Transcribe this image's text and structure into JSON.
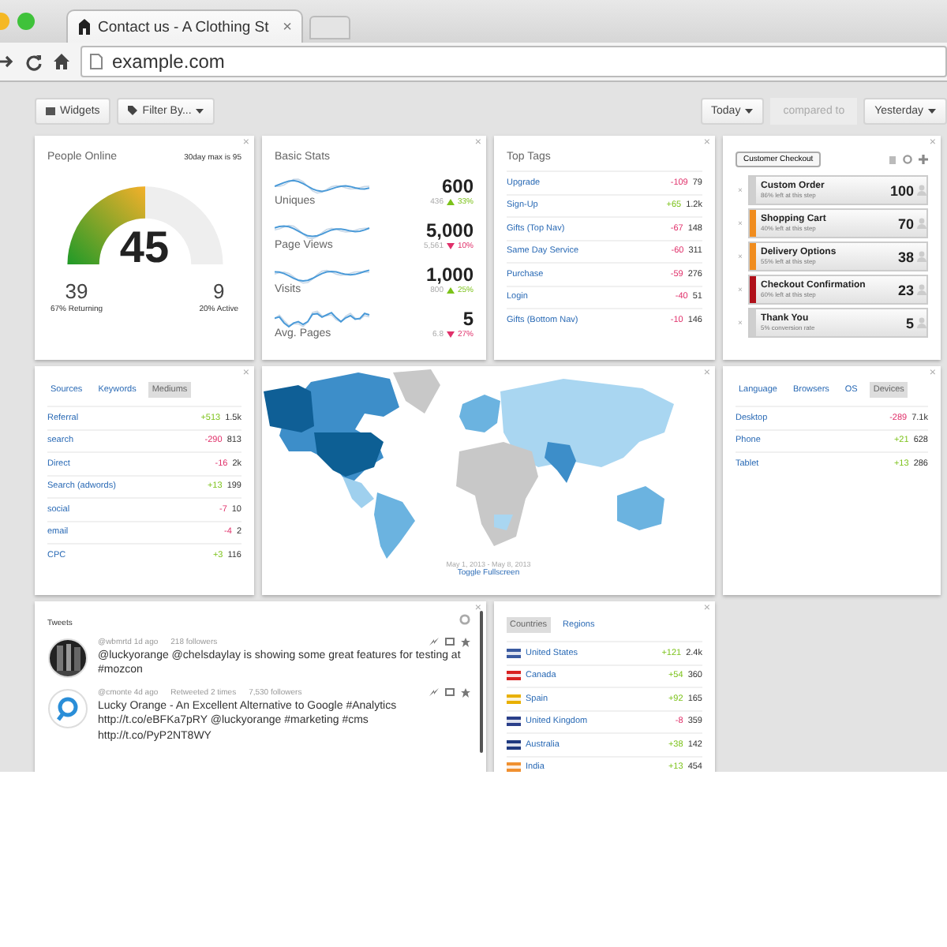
{
  "browser": {
    "tab_title": "Contact us - A Clothing St",
    "tab_close": "×",
    "url": "example.com"
  },
  "toolbar": {
    "widgets_button": "Widgets",
    "filter_button": "Filter By...",
    "range": "Today",
    "compare_label": "compared to",
    "compare_range": "Yesterday"
  },
  "people_online": {
    "close": "×",
    "title": "People Online",
    "max_note": "30day max is 95",
    "count": "45",
    "level": 0.5,
    "returning": "39",
    "returning_label": "67% Returning",
    "active": "9",
    "active_label": "20% Active"
  },
  "basic_stats": {
    "close": "×",
    "title": "Basic Stats",
    "rows": [
      {
        "label": "Uniques",
        "value": "600",
        "previous": "436",
        "change": "33%",
        "kind": "up"
      },
      {
        "label": "Page Views",
        "value": "5,000",
        "previous": "5,561",
        "change": "10%",
        "kind": "down"
      },
      {
        "label": "Visits",
        "value": "1,000",
        "previous": "800",
        "change": "25%",
        "kind": "up"
      },
      {
        "label": "Avg. Pages",
        "value": "5",
        "previous": "6.8",
        "change": "27%",
        "kind": "down"
      }
    ]
  },
  "top_tags": {
    "close": "×",
    "title": "Top Tags",
    "rows": [
      {
        "label": "Upgrade",
        "change": "-109",
        "value": "79",
        "kind": "down"
      },
      {
        "label": "Sign-Up",
        "change": "+65",
        "value": "1.2k",
        "kind": "up"
      },
      {
        "label": "Gifts (Top Nav)",
        "change": "-67",
        "value": "148",
        "kind": "down"
      },
      {
        "label": "Same Day Service",
        "change": "-60",
        "value": "311",
        "kind": "down"
      },
      {
        "label": "Purchase",
        "change": "-59",
        "value": "276",
        "kind": "down"
      },
      {
        "label": "Login",
        "change": "-40",
        "value": "51",
        "kind": "down"
      },
      {
        "label": "Gifts (Bottom Nav)",
        "change": "-10",
        "value": "146",
        "kind": "down"
      }
    ]
  },
  "checkout": {
    "close": "×",
    "funnel": "Customer Checkout",
    "steps": [
      {
        "remove": "×",
        "name": "Custom Order",
        "note": "86% left at this step",
        "count": "100",
        "color": "#cfcfcf"
      },
      {
        "remove": "×",
        "name": "Shopping Cart",
        "note": "40% left at this step",
        "count": "70",
        "color": "#f08c1e"
      },
      {
        "remove": "×",
        "name": "Delivery Options",
        "note": "55% left at this step",
        "count": "38",
        "color": "#f08c1e"
      },
      {
        "remove": "×",
        "name": "Checkout Confirmation",
        "note": "60% left at this step",
        "count": "23",
        "color": "#b0101a"
      },
      {
        "remove": "×",
        "name": "Thank You",
        "note": "5% conversion rate",
        "count": "5",
        "color": "#cfcfcf"
      }
    ]
  },
  "sources": {
    "close": "×",
    "tabs": [
      {
        "label": "Sources",
        "selected": false
      },
      {
        "label": "Keywords",
        "selected": false
      },
      {
        "label": "Mediums",
        "selected": true
      }
    ],
    "rows": [
      {
        "label": "Referral",
        "change": "+513",
        "value": "1.5k",
        "kind": "up"
      },
      {
        "label": "search",
        "change": "-290",
        "value": "813",
        "kind": "down"
      },
      {
        "label": "Direct",
        "change": "-16",
        "value": "2k",
        "kind": "down"
      },
      {
        "label": "Search (adwords)",
        "change": "+13",
        "value": "199",
        "kind": "up"
      },
      {
        "label": "social",
        "change": "-7",
        "value": "10",
        "kind": "down"
      },
      {
        "label": "email",
        "change": "-4",
        "value": "2",
        "kind": "down"
      },
      {
        "label": "CPC",
        "change": "+3",
        "value": "116",
        "kind": "up"
      }
    ]
  },
  "map": {
    "close": "×",
    "date_range": "May 1, 2013 - May 8, 2013",
    "toggle_link": "Toggle Fullscreen"
  },
  "devices": {
    "close": "×",
    "tabs": [
      {
        "label": "Language",
        "selected": false
      },
      {
        "label": "Browsers",
        "selected": false
      },
      {
        "label": "OS",
        "selected": false
      },
      {
        "label": "Devices",
        "selected": true
      }
    ],
    "rows": [
      {
        "label": "Desktop",
        "change": "-289",
        "value": "7.1k",
        "kind": "down"
      },
      {
        "label": "Phone",
        "change": "+21",
        "value": "628",
        "kind": "up"
      },
      {
        "label": "Tablet",
        "change": "+13",
        "value": "286",
        "kind": "up"
      }
    ]
  },
  "tweets": {
    "close": "×",
    "title": "Tweets",
    "items": [
      {
        "handle": "@wbmrtd",
        "age": "1d ago",
        "followers": "218 followers",
        "text": "@luckyorange @chelsdaylay is showing some great features for testing at #mozcon"
      },
      {
        "kind": "logo",
        "handle": "@cmonte",
        "age": "4d ago",
        "retweets": "Retweeted 2 times",
        "followers": "7,530 followers",
        "text": "Lucky Orange - An Excellent Alternative to Google #Analytics http://t.co/eBFKa7pRY @luckyorange #marketing #cms http://t.co/PyP2NT8WY"
      }
    ]
  },
  "countries": {
    "close": "×",
    "tabs": [
      {
        "label": "Countries",
        "selected": true
      },
      {
        "label": "Regions",
        "selected": false
      }
    ],
    "rows": [
      {
        "label": "United States",
        "change": "+121",
        "value": "2.4k",
        "kind": "up",
        "color": "#3a5aa0"
      },
      {
        "label": "Canada",
        "change": "+54",
        "value": "360",
        "kind": "up",
        "color": "#d82020"
      },
      {
        "label": "Spain",
        "change": "+92",
        "value": "165",
        "kind": "up",
        "color": "#e8b000"
      },
      {
        "label": "United Kingdom",
        "change": "-8",
        "value": "359",
        "kind": "down",
        "color": "#2a3f8a"
      },
      {
        "label": "Australia",
        "change": "+38",
        "value": "142",
        "kind": "up",
        "color": "#1f3a80"
      },
      {
        "label": "India",
        "change": "+13",
        "value": "454",
        "kind": "up",
        "color": "#f09030"
      }
    ]
  }
}
